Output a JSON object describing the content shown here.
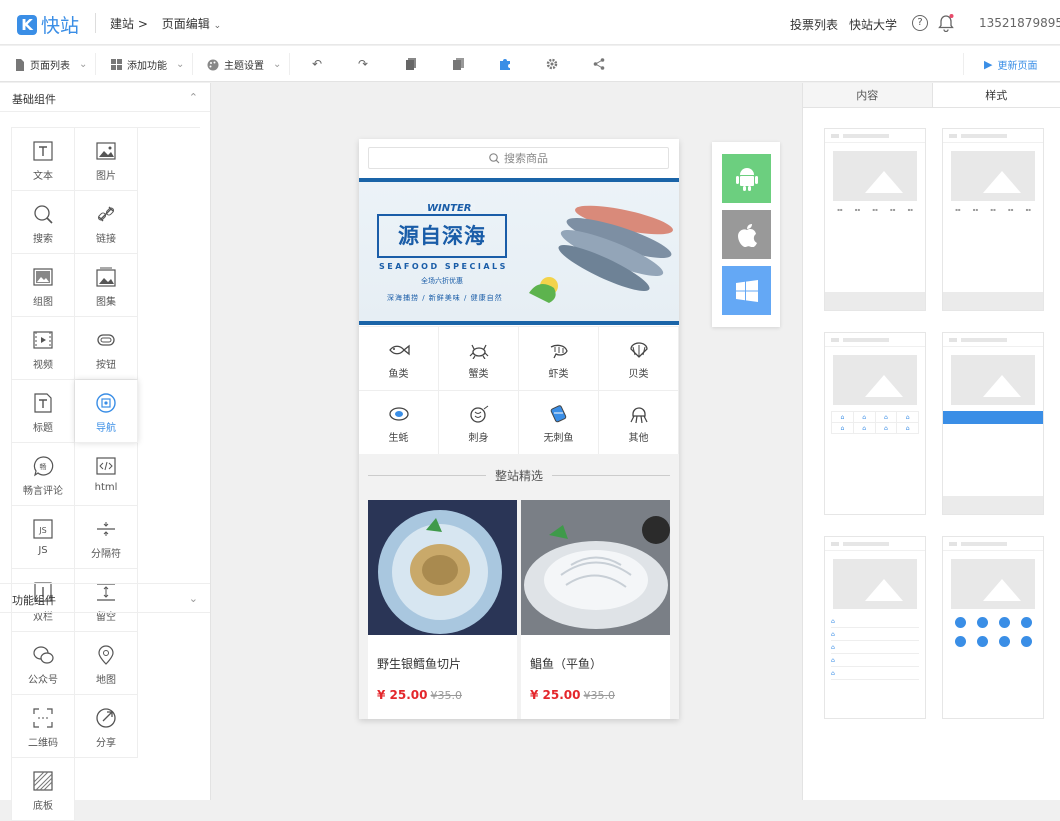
{
  "header": {
    "logo_mark": "K",
    "logo_text": "快站",
    "breadcrumb_site": "建站",
    "breadcrumb_sep": ">",
    "breadcrumb_page": "页面编辑",
    "vote_list": "投票列表",
    "university": "快站大学",
    "help_glyph": "?",
    "phone": "13521879895"
  },
  "toolbar": {
    "page_list": "页面列表",
    "add_feature": "添加功能",
    "theme_settings": "主题设置",
    "update_page": "更新页面"
  },
  "left_panel": {
    "basic_components": "基础组件",
    "function_components": "功能组件",
    "components": [
      {
        "label": "文本",
        "icon": "text-icon"
      },
      {
        "label": "图片",
        "icon": "image-icon"
      },
      {
        "label": "搜索",
        "icon": "search-icon"
      },
      {
        "label": "链接",
        "icon": "link-icon"
      },
      {
        "label": "组图",
        "icon": "image-group-icon"
      },
      {
        "label": "图集",
        "icon": "album-icon"
      },
      {
        "label": "视频",
        "icon": "video-icon"
      },
      {
        "label": "按钮",
        "icon": "button-icon"
      },
      {
        "label": "标题",
        "icon": "title-icon"
      },
      {
        "label": "导航",
        "icon": "navigation-icon"
      },
      {
        "label": "畅言评论",
        "icon": "comment-icon"
      },
      {
        "label": "html",
        "icon": "html-icon"
      },
      {
        "label": "JS",
        "icon": "js-icon"
      },
      {
        "label": "分隔符",
        "icon": "divider-icon"
      },
      {
        "label": "双栏",
        "icon": "two-column-icon"
      },
      {
        "label": "留空",
        "icon": "blank-space-icon"
      },
      {
        "label": "公众号",
        "icon": "wechat-icon"
      },
      {
        "label": "地图",
        "icon": "map-pin-icon"
      },
      {
        "label": "二维码",
        "icon": "qrcode-icon"
      },
      {
        "label": "分享",
        "icon": "share-icon"
      },
      {
        "label": "底板",
        "icon": "background-board-icon"
      }
    ],
    "selected_component": "导航"
  },
  "phone": {
    "search_placeholder": "搜索商品",
    "banner": {
      "winter": "WINTER",
      "headline": "源自深海",
      "subtitle": "SEAFOOD SPECIALS",
      "sale": "全场六折优惠",
      "tagline": "深海捕捞 / 新鲜美味 / 健康自然"
    },
    "categories": [
      {
        "label": "鱼类",
        "icon": "fish-icon"
      },
      {
        "label": "蟹类",
        "icon": "crab-icon"
      },
      {
        "label": "虾类",
        "icon": "shrimp-icon"
      },
      {
        "label": "贝类",
        "icon": "shell-icon"
      },
      {
        "label": "生蚝",
        "icon": "oyster-icon"
      },
      {
        "label": "刺身",
        "icon": "sashimi-icon"
      },
      {
        "label": "无刺鱼",
        "icon": "boneless-fish-icon"
      },
      {
        "label": "其他",
        "icon": "octopus-icon"
      }
    ],
    "featured_title": "整站精选",
    "products": [
      {
        "name": "野生银鳕鱼切片",
        "currency": "¥",
        "price": "25.00",
        "old_price": "¥35.0"
      },
      {
        "name": "鲳鱼（平鱼）",
        "currency": "¥",
        "price": "25.00",
        "old_price": "¥35.0"
      }
    ]
  },
  "platforms": [
    {
      "name": "android-icon",
      "color": "#6ccf7f"
    },
    {
      "name": "apple-icon",
      "color": "#999999"
    },
    {
      "name": "windows-icon",
      "color": "#64a8f5"
    }
  ],
  "right_panel": {
    "tab_content": "内容",
    "tab_style": "样式",
    "active_tab": "样式"
  },
  "colors": {
    "brand": "#3a8ee6",
    "price": "#e4272c",
    "banner_blue": "#1a5da8"
  }
}
